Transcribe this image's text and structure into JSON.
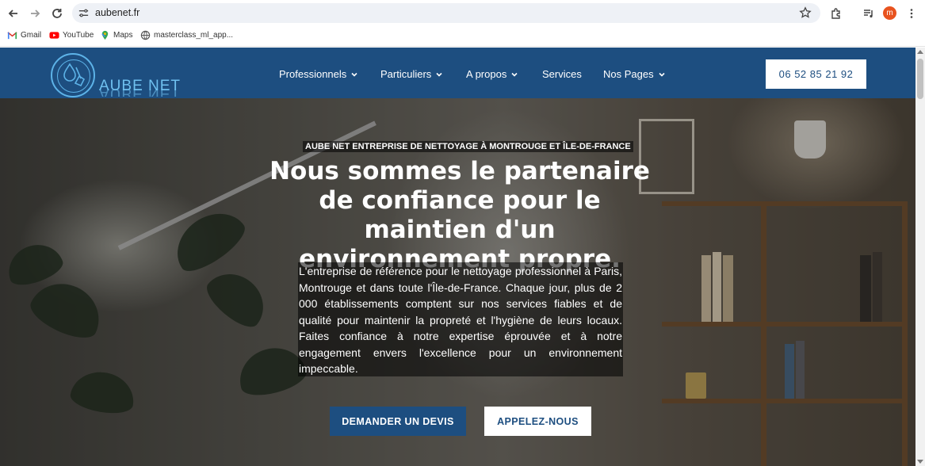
{
  "browser": {
    "url": "aubenet.fr",
    "profile_initial": "m",
    "icons": {
      "back": "arrow-left-icon",
      "forward": "arrow-right-icon",
      "reload": "reload-icon",
      "site_info": "tune-icon",
      "bookmark_star": "star-icon",
      "extensions": "puzzle-icon",
      "media": "media-queue-icon",
      "menu": "kebab-menu-icon"
    }
  },
  "bookmarks": [
    {
      "label": "Gmail",
      "icon": "gmail-icon"
    },
    {
      "label": "YouTube",
      "icon": "youtube-icon"
    },
    {
      "label": "Maps",
      "icon": "maps-icon"
    },
    {
      "label": "masterclass_ml_app...",
      "icon": "globe-icon"
    }
  ],
  "site": {
    "logo_text": "AUBE NET",
    "nav": [
      {
        "label": "Professionnels",
        "has_dropdown": true
      },
      {
        "label": "Particuliers",
        "has_dropdown": true
      },
      {
        "label": "A propos",
        "has_dropdown": true
      },
      {
        "label": "Services",
        "has_dropdown": false
      },
      {
        "label": "Nos Pages",
        "has_dropdown": true
      }
    ],
    "phone": "06 52 85 21 92",
    "hero": {
      "eyebrow": "AUBE NET ENTREPRISE DE NETTOYAGE À MONTROUGE ET ÎLE-DE-FRANCE",
      "headline": "Nous sommes le partenaire de confiance pour le maintien d'un environnement propre.",
      "description": "L'entreprise de référence pour le nettoyage professionnel à Paris, Montrouge et dans toute l'Île-de-France. Chaque jour, plus de 2 000 établissements comptent sur nos services fiables et de qualité pour maintenir la propreté et l'hygiène de leurs locaux. Faites confiance à notre expertise éprouvée et à notre engagement envers l'excellence pour un environnement impeccable.",
      "cta_primary": "DEMANDER UN DEVIS",
      "cta_secondary": "APPELEZ-NOUS"
    },
    "colors": {
      "brand_blue": "#1d4e80",
      "logo_cyan": "#6fc0ef",
      "white": "#ffffff"
    }
  }
}
